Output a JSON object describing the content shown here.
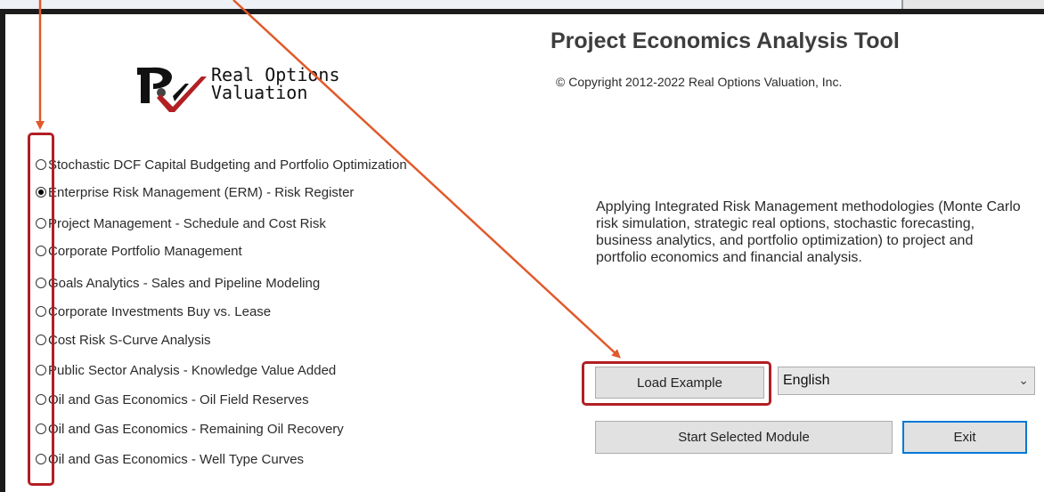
{
  "app": {
    "title": "Project Economics Analysis Tool",
    "copyright": "© Copyright 2012-2022 Real Options Valuation, Inc.",
    "description": "Applying Integrated Risk Management methodologies (Monte Carlo risk simulation, strategic real options, stochastic forecasting, business analytics, and portfolio optimization) to project and portfolio economics and financial analysis."
  },
  "logo": {
    "line1": "Real Options",
    "line2": "Valuation",
    "icon": "rov-logo-icon"
  },
  "modules": [
    {
      "label": "Stochastic DCF Capital Budgeting and Portfolio Optimization",
      "selected": false
    },
    {
      "label": "Enterprise Risk Management (ERM) - Risk Register",
      "selected": true
    },
    {
      "label": "Project Management - Schedule and Cost Risk",
      "selected": false
    },
    {
      "label": "Corporate Portfolio Management",
      "selected": false
    },
    {
      "label": "Goals Analytics - Sales and Pipeline Modeling",
      "selected": false
    },
    {
      "label": "Corporate Investments Buy vs. Lease",
      "selected": false
    },
    {
      "label": "Cost Risk S-Curve Analysis",
      "selected": false
    },
    {
      "label": "Public Sector Analysis - Knowledge Value Added",
      "selected": false
    },
    {
      "label": "Oil and Gas Economics - Oil Field Reserves",
      "selected": false
    },
    {
      "label": "Oil and Gas Economics - Remaining Oil Recovery",
      "selected": false
    },
    {
      "label": "Oil and Gas Economics - Well Type Curves",
      "selected": false
    }
  ],
  "buttons": {
    "load_example": "Load Example",
    "start_module": "Start Selected Module",
    "exit": "Exit"
  },
  "language_select": {
    "value": "English"
  },
  "annotations": {
    "highlight_color": "#b21f24",
    "arrow_color": "#e05a2b"
  }
}
